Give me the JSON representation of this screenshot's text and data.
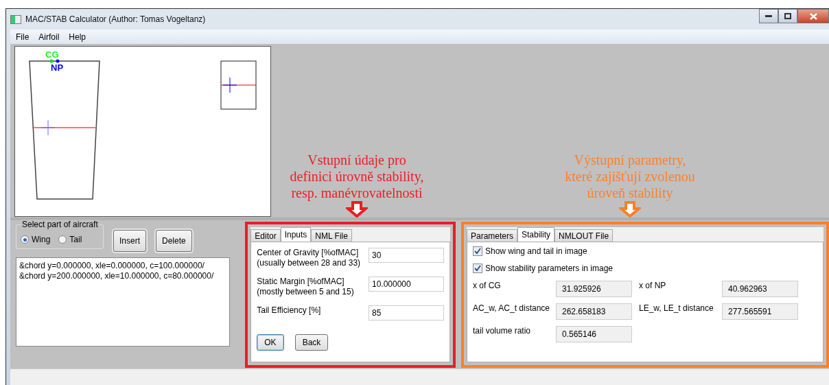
{
  "window": {
    "title": "MAC/STAB Calculator (Author: Tomas Vogeltanz)"
  },
  "menu": [
    "File",
    "Airfoil",
    "Help"
  ],
  "drawing": {
    "cg_label": "CG",
    "np_label": "NP"
  },
  "annotations": [
    {
      "kind": "input",
      "color": "#ed1c24",
      "lines": [
        "Vstupní údaje pro",
        "definici úrovně stability,",
        "resp. manévrovatelnosti"
      ]
    },
    {
      "kind": "output",
      "color": "#ff7f27",
      "lines": [
        "Výstupní parametry,",
        "které zajišťují zvolenou",
        "úroveň stability"
      ]
    }
  ],
  "part_selector": {
    "title": "Select part of aircraft",
    "options": [
      {
        "label": "Wing",
        "selected": true
      },
      {
        "label": "Tail",
        "selected": false
      }
    ]
  },
  "buttons": [
    "Insert",
    "Delete"
  ],
  "chord_list": [
    "&chord y=0.000000, xle=0.000000, c=100.000000/",
    "&chord y=200.000000, xle=10.000000, c=80.000000/"
  ],
  "input_panel": {
    "tabs": [
      {
        "label": "Editor",
        "selected": false
      },
      {
        "label": "Inputs",
        "selected": true
      },
      {
        "label": "NML File",
        "selected": false
      }
    ],
    "fields": [
      {
        "label": "Center of Gravity [%ofMAC]",
        "hint": "(usually between 28 and 33)",
        "value": "30"
      },
      {
        "label": "Static Margin [%ofMAC]",
        "hint": "(mostly between 5 and 15)",
        "value": "10.000000"
      },
      {
        "label": "Tail Efficiency [%]",
        "value": "85"
      }
    ],
    "buttons": [
      {
        "label": "OK",
        "focused": true
      },
      {
        "label": "Back",
        "focused": false
      }
    ]
  },
  "output_panel": {
    "tabs": [
      {
        "label": "Parameters",
        "selected": false
      },
      {
        "label": "Stability",
        "selected": true
      },
      {
        "label": "NMLOUT File",
        "selected": false
      }
    ],
    "checkboxes": [
      {
        "label": "Show wing and tail in image",
        "checked": true
      },
      {
        "label": "Show stability parameters in image",
        "checked": true
      }
    ],
    "fields": [
      {
        "label": "x of CG",
        "value": "31.925926"
      },
      {
        "label": "x of NP",
        "value": "40.962963"
      },
      {
        "label": "AC_w, AC_t distance",
        "value": "262.658183"
      },
      {
        "label": "LE_w, LE_t distance",
        "value": "277.565591"
      },
      {
        "label": "tail volume ratio",
        "value": "0.565146"
      }
    ]
  }
}
